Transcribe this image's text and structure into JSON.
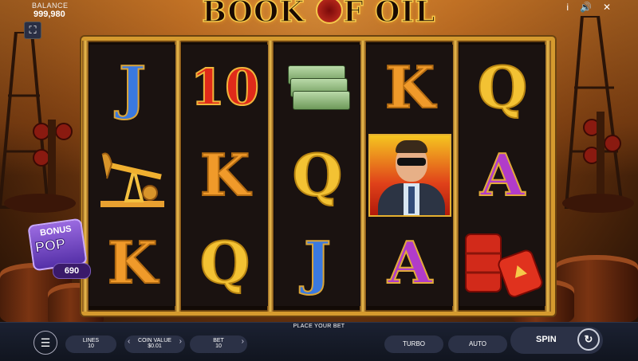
{
  "header": {
    "balance_label": "BALANCE",
    "balance_value": "999,980",
    "logo_left": "BOOK ",
    "logo_right": "F OIL",
    "info_icon": "i",
    "sound_icon": "🔊",
    "close_icon": "✕"
  },
  "reels": [
    [
      {
        "type": "letter",
        "value": "J",
        "cls": "J"
      },
      {
        "type": "pump"
      },
      {
        "type": "letter",
        "value": "K",
        "cls": "K"
      }
    ],
    [
      {
        "type": "letter",
        "value": "10",
        "cls": "T"
      },
      {
        "type": "letter",
        "value": "K",
        "cls": "K"
      },
      {
        "type": "letter",
        "value": "Q",
        "cls": "Q"
      }
    ],
    [
      {
        "type": "money"
      },
      {
        "type": "letter",
        "value": "Q",
        "cls": "Q"
      },
      {
        "type": "letter",
        "value": "J",
        "cls": "J"
      }
    ],
    [
      {
        "type": "letter",
        "value": "K",
        "cls": "K"
      },
      {
        "type": "man"
      },
      {
        "type": "letter",
        "value": "A",
        "cls": "A"
      }
    ],
    [
      {
        "type": "letter",
        "value": "Q",
        "cls": "Q"
      },
      {
        "type": "letter",
        "value": "A",
        "cls": "A"
      },
      {
        "type": "barrels"
      }
    ]
  ],
  "bonus": {
    "line1": "BONUS",
    "line2": "POP",
    "count": "690"
  },
  "controls": {
    "place_bet": "PLACE YOUR BET",
    "lines_label": "LINES",
    "lines_value": "10",
    "coin_label": "COIN VALUE",
    "coin_value": "$0.01",
    "bet_label": "BET",
    "bet_value": "10",
    "turbo": "TURBO",
    "auto": "AUTO",
    "spin": "SPIN"
  }
}
